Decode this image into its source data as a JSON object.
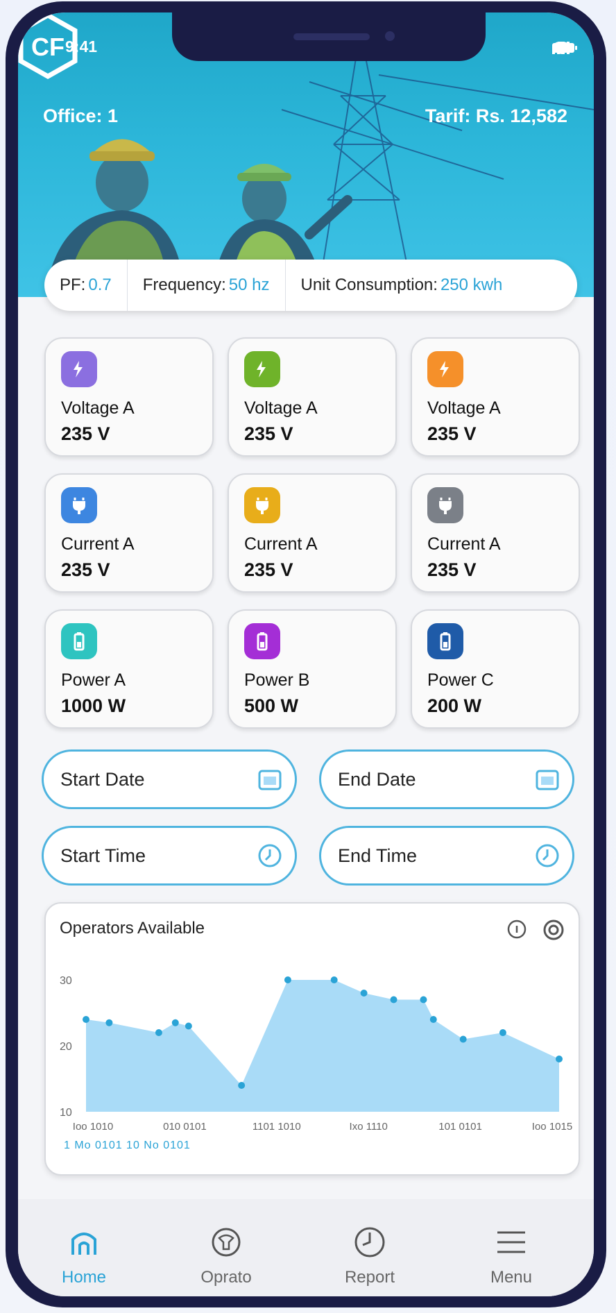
{
  "status": {
    "time": "9:41"
  },
  "header": {
    "office": "Office: 1",
    "tariff": "Tarif: Rs. 12,582",
    "logo_text": "CF"
  },
  "metrics": [
    {
      "label": "PF:",
      "value": "0.7"
    },
    {
      "label": "Frequency:",
      "value": "50 hz"
    },
    {
      "label": "Unit Consumption:",
      "value": "250 kwh"
    }
  ],
  "cards": [
    {
      "label": "Voltage A",
      "value": "235 V",
      "icon": "bolt-icon",
      "color": "#8b6fe0"
    },
    {
      "label": "Voltage A",
      "value": "235 V",
      "icon": "bolt-icon",
      "color": "#6fb32a"
    },
    {
      "label": "Voltage A",
      "value": "235 V",
      "icon": "bolt-icon",
      "color": "#f5902a"
    },
    {
      "label": "Current A",
      "value": "235 V",
      "icon": "plug-icon",
      "color": "#3d86e0"
    },
    {
      "label": "Current A",
      "value": "235 V",
      "icon": "plug-icon",
      "color": "#e8ad1a"
    },
    {
      "label": "Current A",
      "value": "235 V",
      "icon": "plug-icon",
      "color": "#7b8088"
    },
    {
      "label": "Power A",
      "value": "1000 W",
      "icon": "battery-icon",
      "color": "#2ec4c0"
    },
    {
      "label": "Power B",
      "value": "500 W",
      "icon": "battery-icon",
      "color": "#a42ed6"
    },
    {
      "label": "Power C",
      "value": "200 W",
      "icon": "battery-icon",
      "color": "#1f5ba8"
    }
  ],
  "pickers": {
    "start_date": "Start Date",
    "end_date": "End Date",
    "start_time": "Start Time",
    "end_time": "End Time"
  },
  "chart": {
    "title": "Operators Available",
    "date_range": "1 Mo 0101 10 No 0101"
  },
  "chart_data": {
    "type": "area",
    "title": "Operators Available",
    "xlabel": "",
    "ylabel": "",
    "ylim": [
      10,
      30
    ],
    "y_ticks": [
      "30",
      "20",
      "10"
    ],
    "x_tick_labels": [
      "Ioo 1010",
      "010 0101",
      "1101 1010",
      "Ixo 1110",
      "101 0101",
      "Ioo 1015"
    ],
    "x": [
      0,
      0.7,
      2.2,
      2.7,
      3.1,
      4.7,
      6.1,
      7.5,
      8.4,
      9.3,
      10.2,
      10.5,
      11.4,
      12.6,
      14.3
    ],
    "values": [
      24,
      23.5,
      22,
      23.5,
      23,
      14,
      30,
      30,
      28,
      27,
      27,
      24,
      21,
      22,
      18
    ],
    "color": "#a9dbf7",
    "point_color": "#2aa3d6"
  },
  "nav": [
    {
      "label": "Home",
      "icon": "home-icon",
      "active": true
    },
    {
      "label": "Oprato",
      "icon": "operator-icon",
      "active": false
    },
    {
      "label": "Report",
      "icon": "clock-icon",
      "active": false
    },
    {
      "label": "Menu",
      "icon": "menu-icon",
      "active": false
    }
  ]
}
